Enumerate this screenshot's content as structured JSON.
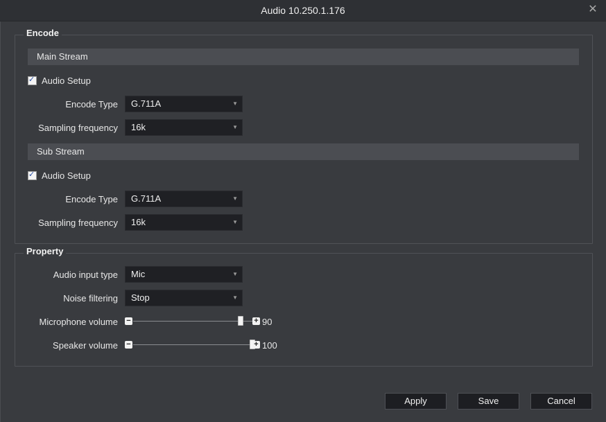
{
  "window": {
    "title": "Audio 10.250.1.176",
    "close_icon": "close-icon"
  },
  "encode": {
    "legend": "Encode",
    "main_stream": {
      "header": "Main Stream",
      "audio_setup": {
        "label": "Audio Setup",
        "checked": true
      },
      "encode_type": {
        "label": "Encode Type",
        "value": "G.711A"
      },
      "sampling_frequency": {
        "label": "Sampling frequency",
        "value": "16k"
      }
    },
    "sub_stream": {
      "header": "Sub Stream",
      "audio_setup": {
        "label": "Audio Setup",
        "checked": true
      },
      "encode_type": {
        "label": "Encode Type",
        "value": "G.711A"
      },
      "sampling_frequency": {
        "label": "Sampling frequency",
        "value": "16k"
      }
    }
  },
  "property": {
    "legend": "Property",
    "audio_input_type": {
      "label": "Audio input type",
      "value": "Mic"
    },
    "noise_filtering": {
      "label": "Noise filtering",
      "value": "Stop"
    },
    "microphone_volume": {
      "label": "Microphone volume",
      "value": "90",
      "min": 0,
      "max": 100
    },
    "speaker_volume": {
      "label": "Speaker volume",
      "value": "100",
      "min": 0,
      "max": 100
    }
  },
  "buttons": {
    "apply": "Apply",
    "save": "Save",
    "cancel": "Cancel"
  },
  "colors": {
    "background": "#393b3f",
    "titlebar": "#2e3034",
    "input_bg": "#1f2024",
    "section_bar": "#4b4d52"
  }
}
